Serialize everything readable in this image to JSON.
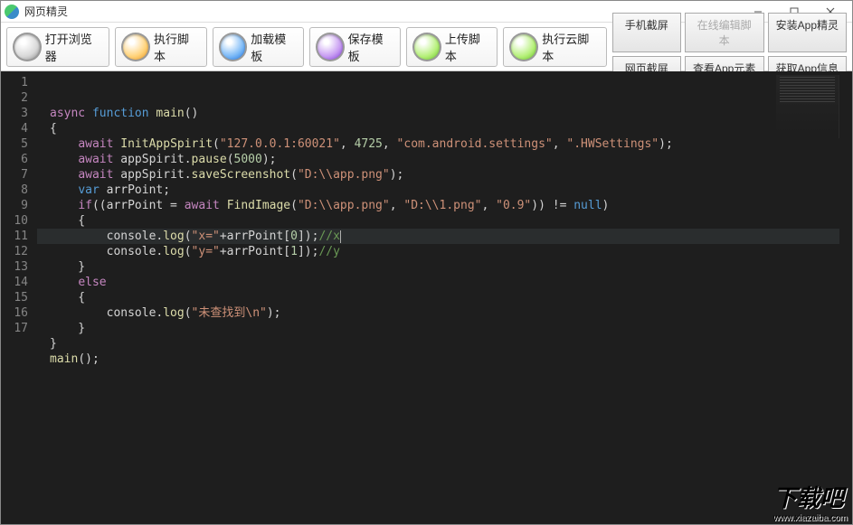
{
  "window": {
    "title": "网页精灵",
    "min": "–",
    "max": "☐",
    "close": "✕"
  },
  "toolbar": [
    {
      "name": "open-browser",
      "label": "打开浏览器",
      "c": "#d8d8d8",
      "c2": "#888"
    },
    {
      "name": "run-script",
      "label": "执行脚本",
      "c": "#ffd37a",
      "c2": "#e8921a"
    },
    {
      "name": "load-template",
      "label": "加载模板",
      "c": "#7cbaf7",
      "c2": "#1a6fe0"
    },
    {
      "name": "save-template",
      "label": "保存模板",
      "c": "#c79bf2",
      "c2": "#7a33d8"
    },
    {
      "name": "upload-script",
      "label": "上传脚本",
      "c": "#b6f07a",
      "c2": "#5fbf1e"
    },
    {
      "name": "run-cloud",
      "label": "执行云脚本",
      "c": "#b6f07a",
      "c2": "#5fbf1e"
    }
  ],
  "sideButtons": [
    {
      "name": "phone-screenshot",
      "label": "手机截屏",
      "disabled": false
    },
    {
      "name": "online-edit",
      "label": "在线编辑脚本",
      "disabled": true
    },
    {
      "name": "install-app",
      "label": "安装App精灵",
      "disabled": false
    },
    {
      "name": "page-screenshot",
      "label": "网页截屏",
      "disabled": false
    },
    {
      "name": "view-elements",
      "label": "查看App元素",
      "disabled": false
    },
    {
      "name": "get-app-info",
      "label": "获取App信息",
      "disabled": false
    }
  ],
  "code": {
    "highlightLine": 9,
    "lines": [
      [
        [
          "kw",
          "async"
        ],
        [
          "pn",
          " "
        ],
        [
          "kw2",
          "function"
        ],
        [
          "pn",
          " "
        ],
        [
          "fn",
          "main"
        ],
        [
          "pn",
          "()"
        ]
      ],
      [
        [
          "pn",
          "{"
        ]
      ],
      [
        [
          "pn",
          "    "
        ],
        [
          "kw",
          "await"
        ],
        [
          "pn",
          " "
        ],
        [
          "fn",
          "InitAppSpirit"
        ],
        [
          "pn",
          "("
        ],
        [
          "str",
          "\"127.0.0.1:60021\""
        ],
        [
          "pn",
          ", "
        ],
        [
          "num",
          "4725"
        ],
        [
          "pn",
          ", "
        ],
        [
          "str",
          "\"com.android.settings\""
        ],
        [
          "pn",
          ", "
        ],
        [
          "str",
          "\".HWSettings\""
        ],
        [
          "pn",
          ");"
        ]
      ],
      [
        [
          "pn",
          "    "
        ],
        [
          "kw",
          "await"
        ],
        [
          "pn",
          " appSpirit."
        ],
        [
          "fn",
          "pause"
        ],
        [
          "pn",
          "("
        ],
        [
          "num",
          "5000"
        ],
        [
          "pn",
          ");"
        ]
      ],
      [
        [
          "pn",
          "    "
        ],
        [
          "kw",
          "await"
        ],
        [
          "pn",
          " appSpirit."
        ],
        [
          "fn",
          "saveScreenshot"
        ],
        [
          "pn",
          "("
        ],
        [
          "str",
          "\"D:\\\\app.png\""
        ],
        [
          "pn",
          ");"
        ]
      ],
      [
        [
          "pn",
          "    "
        ],
        [
          "kw2",
          "var"
        ],
        [
          "pn",
          " arrPoint;"
        ]
      ],
      [
        [
          "pn",
          "    "
        ],
        [
          "kw",
          "if"
        ],
        [
          "pn",
          "((arrPoint = "
        ],
        [
          "kw",
          "await"
        ],
        [
          "pn",
          " "
        ],
        [
          "fn",
          "FindImage"
        ],
        [
          "pn",
          "("
        ],
        [
          "str",
          "\"D:\\\\app.png\""
        ],
        [
          "pn",
          ", "
        ],
        [
          "str",
          "\"D:\\\\1.png\""
        ],
        [
          "pn",
          ", "
        ],
        [
          "str",
          "\"0.9\""
        ],
        [
          "pn",
          ")) != "
        ],
        [
          "kw2",
          "null"
        ],
        [
          "pn",
          ")"
        ]
      ],
      [
        [
          "pn",
          "    {"
        ]
      ],
      [
        [
          "pn",
          "        console."
        ],
        [
          "fn",
          "log"
        ],
        [
          "pn",
          "("
        ],
        [
          "str",
          "\"x=\""
        ],
        [
          "pn",
          "+arrPoint["
        ],
        [
          "num",
          "0"
        ],
        [
          "pn",
          "]);"
        ],
        [
          "cm",
          "//x"
        ]
      ],
      [
        [
          "pn",
          "        console."
        ],
        [
          "fn",
          "log"
        ],
        [
          "pn",
          "("
        ],
        [
          "str",
          "\"y=\""
        ],
        [
          "pn",
          "+arrPoint["
        ],
        [
          "num",
          "1"
        ],
        [
          "pn",
          "]);"
        ],
        [
          "cm",
          "//y"
        ]
      ],
      [
        [
          "pn",
          "    }"
        ]
      ],
      [
        [
          "pn",
          "    "
        ],
        [
          "kw",
          "else"
        ]
      ],
      [
        [
          "pn",
          "    {"
        ]
      ],
      [
        [
          "pn",
          "        console."
        ],
        [
          "fn",
          "log"
        ],
        [
          "pn",
          "("
        ],
        [
          "str",
          "\"未查找到\\n\""
        ],
        [
          "pn",
          ");"
        ]
      ],
      [
        [
          "pn",
          "    }"
        ]
      ],
      [
        [
          "pn",
          "}"
        ]
      ],
      [
        [
          "fn",
          "main"
        ],
        [
          "pn",
          "();"
        ]
      ]
    ]
  },
  "watermark": {
    "big": "下载吧",
    "url": "www.xiazaiba.com"
  }
}
